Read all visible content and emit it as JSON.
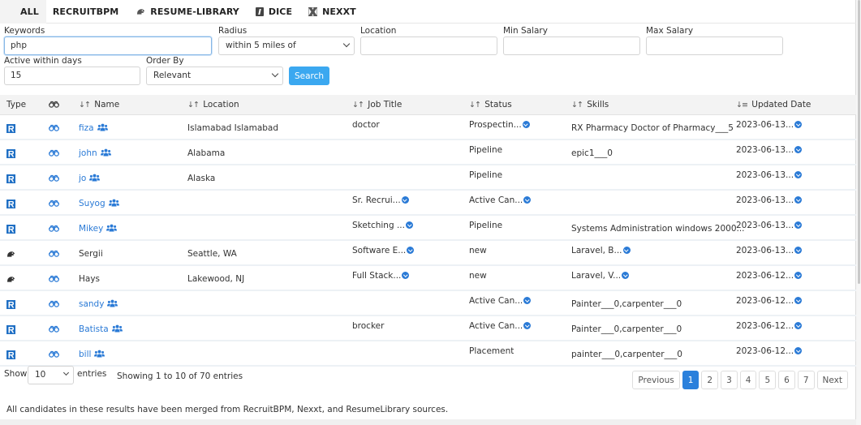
{
  "tabs": [
    {
      "label": "ALL",
      "icon": "none",
      "active": true
    },
    {
      "label": "RECRUITBPM",
      "icon": "none",
      "active": false
    },
    {
      "label": "RESUME-LIBRARY",
      "icon": "resume-library-icon",
      "active": false
    },
    {
      "label": "DICE",
      "icon": "dice-icon",
      "active": false
    },
    {
      "label": "NEXXT",
      "icon": "nexxt-icon",
      "active": false
    }
  ],
  "form": {
    "keywords": {
      "label": "Keywords",
      "value": "php"
    },
    "radius": {
      "label": "Radius",
      "selected": "within 5 miles of"
    },
    "location": {
      "label": "Location",
      "value": ""
    },
    "min_salary": {
      "label": "Min Salary",
      "value": ""
    },
    "max_salary": {
      "label": "Max Salary",
      "value": ""
    },
    "active_days": {
      "label": "Active within days",
      "value": "15"
    },
    "order_by": {
      "label": "Order By",
      "selected": "Relevant"
    },
    "search_label": "Search"
  },
  "table": {
    "columns": {
      "type": "Type",
      "view": "binoculars-icon",
      "name": "Name",
      "location": "Location",
      "job_title": "Job Title",
      "status": "Status",
      "skills": "Skills",
      "updated": "Updated Date"
    },
    "rows": [
      {
        "source": "recruitbpm",
        "name": "fiza",
        "linked": true,
        "location": "Islamabad Islamabad",
        "job_title": "doctor",
        "job_more": false,
        "status": "Prospectin...",
        "status_more": true,
        "skills": "RX Pharmacy Doctor of Pharmacy___5",
        "skills_more": false,
        "updated": "2023-06-13..."
      },
      {
        "source": "recruitbpm",
        "name": "john",
        "linked": true,
        "location": "Alabama",
        "job_title": "",
        "job_more": false,
        "status": "Pipeline",
        "status_more": false,
        "skills": "epic1___0",
        "skills_more": false,
        "updated": "2023-06-13..."
      },
      {
        "source": "recruitbpm",
        "name": "jo",
        "linked": true,
        "location": "Alaska",
        "job_title": "",
        "job_more": false,
        "status": "Pipeline",
        "status_more": false,
        "skills": "",
        "skills_more": false,
        "updated": "2023-06-13..."
      },
      {
        "source": "recruitbpm",
        "name": "Suyog",
        "linked": true,
        "location": "",
        "job_title": "Sr. Recrui...",
        "job_more": true,
        "status": "Active Can...",
        "status_more": true,
        "skills": "",
        "skills_more": false,
        "updated": "2023-06-13..."
      },
      {
        "source": "recruitbpm",
        "name": "Mikey",
        "linked": true,
        "location": "",
        "job_title": "Sketching ...",
        "job_more": true,
        "status": "Pipeline",
        "status_more": false,
        "skills": "Systems Administration windows 2000...",
        "skills_more": false,
        "updated": "2023-06-13..."
      },
      {
        "source": "resume-library",
        "name": "Sergii",
        "linked": false,
        "location": "Seattle, WA",
        "job_title": "Software E...",
        "job_more": true,
        "status": "new",
        "status_more": false,
        "skills": "Laravel, B...",
        "skills_more": true,
        "updated": "2023-06-13..."
      },
      {
        "source": "resume-library",
        "name": "Hays",
        "linked": false,
        "location": "Lakewood, NJ",
        "job_title": "Full Stack...",
        "job_more": true,
        "status": "new",
        "status_more": false,
        "skills": "Laravel, V...",
        "skills_more": true,
        "updated": "2023-06-12..."
      },
      {
        "source": "recruitbpm",
        "name": "sandy",
        "linked": true,
        "location": "",
        "job_title": "",
        "job_more": false,
        "status": "Active Can...",
        "status_more": true,
        "skills": "Painter___0,carpenter___0",
        "skills_more": false,
        "updated": "2023-06-12..."
      },
      {
        "source": "recruitbpm",
        "name": "Batista",
        "linked": true,
        "location": "",
        "job_title": "brocker",
        "job_more": false,
        "status": "Active Can...",
        "status_more": true,
        "skills": "Painter___0,carpenter___0",
        "skills_more": false,
        "updated": "2023-06-12..."
      },
      {
        "source": "recruitbpm",
        "name": "bill",
        "linked": true,
        "location": "",
        "job_title": "",
        "job_more": false,
        "status": "Placement",
        "status_more": false,
        "skills": "painter___0,carpenter___0",
        "skills_more": false,
        "updated": "2023-06-12..."
      }
    ]
  },
  "footer": {
    "show_label": "Show",
    "page_length": "10",
    "entries_label": "entries",
    "info": "Showing 1 to 10 of 70 entries",
    "pagination": {
      "previous": "Previous",
      "pages": [
        "1",
        "2",
        "3",
        "4",
        "5",
        "6",
        "7"
      ],
      "current": "1",
      "next": "Next"
    },
    "note": "All candidates in these results have been merged from RecruitBPM, Nexxt, and ResumeLibrary sources."
  },
  "colors": {
    "accent": "#2a7ad6",
    "search_button": "#3ba8f0",
    "header_bg": "#f3f3f3"
  }
}
